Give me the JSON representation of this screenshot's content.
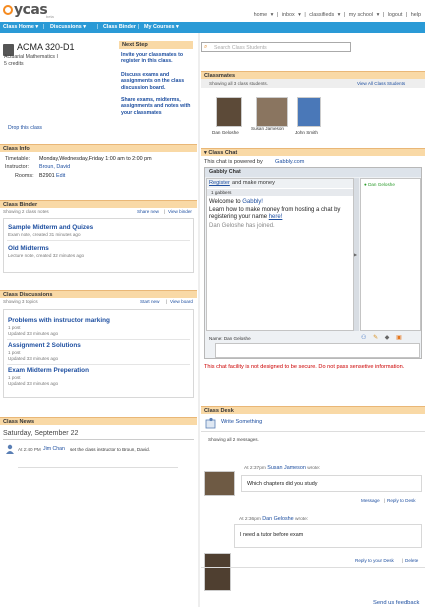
{
  "logo": {
    "text": "ycas",
    "beta": "beta"
  },
  "topnav": [
    "home",
    "inbox",
    "classifieds",
    "my school",
    "logout",
    "help"
  ],
  "tabs": {
    "class_home": "Class Home",
    "discussions": "Discussions",
    "class_binder": "Class Binder",
    "my_courses": "My Courses"
  },
  "course": {
    "code": "ACMA 320-D1",
    "name": "Actuarial Mathematics I",
    "credits": "5 credits",
    "drop": "Drop this class"
  },
  "next_step": {
    "title": "Next Step",
    "items": [
      "Invite your classmates to register in this class.",
      "Discuss exams and assignments on the class discussion board.",
      "Share exams, midterms, assignments and notes with your classmates"
    ]
  },
  "search": {
    "placeholder": "Search Class Students"
  },
  "class_info": {
    "title": "Class Info",
    "timetable_label": "Timetable:",
    "timetable": "Monday,Wednesday,Friday 1:00 am to 2:00 pm",
    "instructor_label": "Instructor:",
    "instructor": "Broun, David",
    "rooms_label": "Rooms:",
    "rooms": "B2901",
    "rooms_edit": "Edit"
  },
  "binder": {
    "title": "Class Binder",
    "count": "Showing 2 class notes",
    "share": "Share new",
    "view": "View binder",
    "notes": [
      {
        "title": "Sample Midterm and Quizes",
        "meta": "Exam note, created 31 minutes ago"
      },
      {
        "title": "Old Midterms",
        "meta": "Lecture note, created 32 minutes ago"
      }
    ]
  },
  "discussions": {
    "title": "Class Discussions",
    "count": "Showing 3 topics",
    "start": "Start new",
    "view": "View board",
    "topics": [
      {
        "title": "Problems with instructor marking",
        "posts": "1 post",
        "updated": "Updated 33 minutes ago"
      },
      {
        "title": "Assignment 2 Solutions",
        "posts": "1 post",
        "updated": "Updated 33 minutes ago"
      },
      {
        "title": "Exam Midterm Preperation",
        "posts": "1 post",
        "updated": "Updated 33 minutes ago"
      }
    ]
  },
  "news": {
    "title": "Class News",
    "date": "Saturday, September 22",
    "time": "At 2:40 PM",
    "who": "Jim Chan",
    "text": "set the class instructor to Broun, David."
  },
  "classmates": {
    "title": "Classmates",
    "count": "Showing all 3 class students.",
    "view_all": "View All Class Students",
    "people": [
      {
        "name": "Dan Geloshe"
      },
      {
        "name": "Susan Jameson"
      },
      {
        "name": "John Smith"
      }
    ]
  },
  "chat": {
    "title": "Class Chat",
    "powered_pre": "This chat is powered by",
    "powered_link": "Gabbly.com",
    "window_title": "Gabbly Chat",
    "register": "Register",
    "register_post": "and make money",
    "gabbers": "1 gabbers",
    "welcome": "Welcome to",
    "welcome_link": "Gabbly!",
    "learn": "Learn how to make money from hosting a chat by registering your name",
    "here": "here!",
    "joined": "Dan Geloshe has joined.",
    "online": "Dan Geloshe",
    "name_label": "Name:",
    "name_value": "Dan Geloshe",
    "warning": "This chat facility is not designed to be secure. Do not pass sensetive information."
  },
  "desk": {
    "title": "Class Desk",
    "write": "Write Something",
    "count": "Showing all 2 messages.",
    "messages": [
      {
        "time": "At 2:37pm",
        "who": "Susan Jameson",
        "wrote": "wrote:",
        "text": "Which chapters did you study",
        "actions": [
          "Message",
          "Reply to Desk"
        ]
      },
      {
        "time": "At 2:36pm",
        "who": "Dan Geloshe",
        "wrote": "wrote:",
        "text": "I need a tutor before exam",
        "actions": [
          "Reply to your Desk",
          "Delete"
        ]
      }
    ]
  },
  "footer": {
    "feedback": "Send us feedback"
  },
  "colors": {
    "header": "#f9d9a6",
    "bar": "#2a9ad6",
    "link": "#1e4fa0",
    "warning": "#cc0000"
  }
}
